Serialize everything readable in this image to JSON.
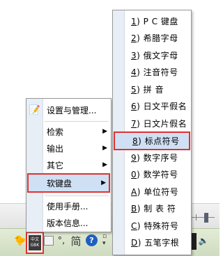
{
  "ime_menu": {
    "settings_label": "设置与管理...",
    "items": [
      {
        "label": "检索",
        "submenu": true
      },
      {
        "label": "输出",
        "submenu": true
      },
      {
        "label": "其它",
        "submenu": true
      },
      {
        "label": "软键盘",
        "submenu": true,
        "highlighted": true
      }
    ],
    "manual_label": "使用手册...",
    "version_label": "版本信息..."
  },
  "soft_keyboard_menu": {
    "items": [
      {
        "key": "1",
        "label": "P C 键盘"
      },
      {
        "key": "2",
        "label": "希腊字母"
      },
      {
        "key": "3",
        "label": "俄文字母"
      },
      {
        "key": "4",
        "label": "注音符号"
      },
      {
        "key": "5",
        "label": "拼    音"
      },
      {
        "key": "6",
        "label": "日文平假名"
      },
      {
        "key": "7",
        "label": "日文片假名"
      },
      {
        "key": "8",
        "label": "标点符号",
        "selected": true
      },
      {
        "key": "9",
        "label": "数字序号"
      },
      {
        "key": "0",
        "label": "数学符号"
      },
      {
        "key": "A",
        "label": "单位符号"
      },
      {
        "key": "B",
        "label": "制 表 符"
      },
      {
        "key": "C",
        "label": "特殊符号"
      },
      {
        "key": "D",
        "label": "五笔字根"
      }
    ]
  },
  "taskbar": {
    "ime_badge_top": "中文",
    "ime_badge_bottom": "GBK",
    "simplified_label": "简",
    "help_label": "?",
    "punctuation_label": "°,"
  },
  "colors": {
    "highlight_border": "#e03030",
    "hover_bg": "#cfe0f5",
    "taskbar_bg": "#d8e4cb"
  }
}
